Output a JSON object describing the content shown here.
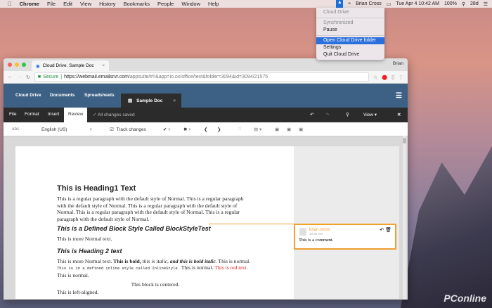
{
  "menubar": {
    "app": "Chrome",
    "items": [
      "File",
      "Edit",
      "View",
      "History",
      "Bookmarks",
      "People",
      "Window",
      "Help"
    ],
    "user": "Brian Cross",
    "datetime": "Tue Apr 4  10:42 AM",
    "battery": "100%",
    "days": "28d"
  },
  "cloud_menu": {
    "title": "Cloud Drive",
    "status": "Synchronized",
    "pause": "Pause",
    "open": "Open Cloud Drive folder",
    "settings": "Settings",
    "quit": "Quit Cloud Drive"
  },
  "browser": {
    "tab_title": "Cloud Drive. Sample Doc",
    "profile": "Brian",
    "secure": "Secure",
    "url_host": "https://webmail.emailsrvr.com",
    "url_path": "/appsuite/#!!&app=io.ox/office/text&folder=3094&id=3094/21575"
  },
  "appnav": {
    "items": [
      "Cloud Drive",
      "Documents",
      "Spreadsheets"
    ],
    "doc_tab": "Sample Doc"
  },
  "toolbar": {
    "menus": [
      "File",
      "Format",
      "Insert",
      "Review"
    ],
    "status": "All changes saved",
    "view": "View"
  },
  "review_toolbar": {
    "language": "English (US)",
    "track_changes": "Track changes",
    "track_checked": true
  },
  "document": {
    "h1": "This is Heading1 Text",
    "p1": "This is a regular paragraph with the default style of Normal. This is a regular paragraph with the default style of Normal. This is a regular paragraph with the default style of Normal. This is a regular paragraph with the default style of Normal. This is a regular paragraph with the default style of Normal.",
    "block_style": "This is a Defined Block Style Called BlockStyleTest",
    "p2": "This is more Normal text.",
    "h2": "This is Heading 2 text",
    "p3a": "This is more Normal text. ",
    "p3bold": "This is bold, ",
    "p3italic": "this is italic",
    "p3b": ", ",
    "p3bi": "and this is bold italic",
    "p3c": ". This is normal. ",
    "p3mono": "This is in a defined inline style called InlineStyle.",
    "p3d": " This is normal. ",
    "p3red": "This is red text.",
    "p3e": " This is normal.",
    "centered": "This block is centered.",
    "left": "This is left-aligned."
  },
  "comment": {
    "author": "brian.cross",
    "time": "10:38 AM",
    "text": "This is a comment."
  },
  "watermark": "PConline"
}
